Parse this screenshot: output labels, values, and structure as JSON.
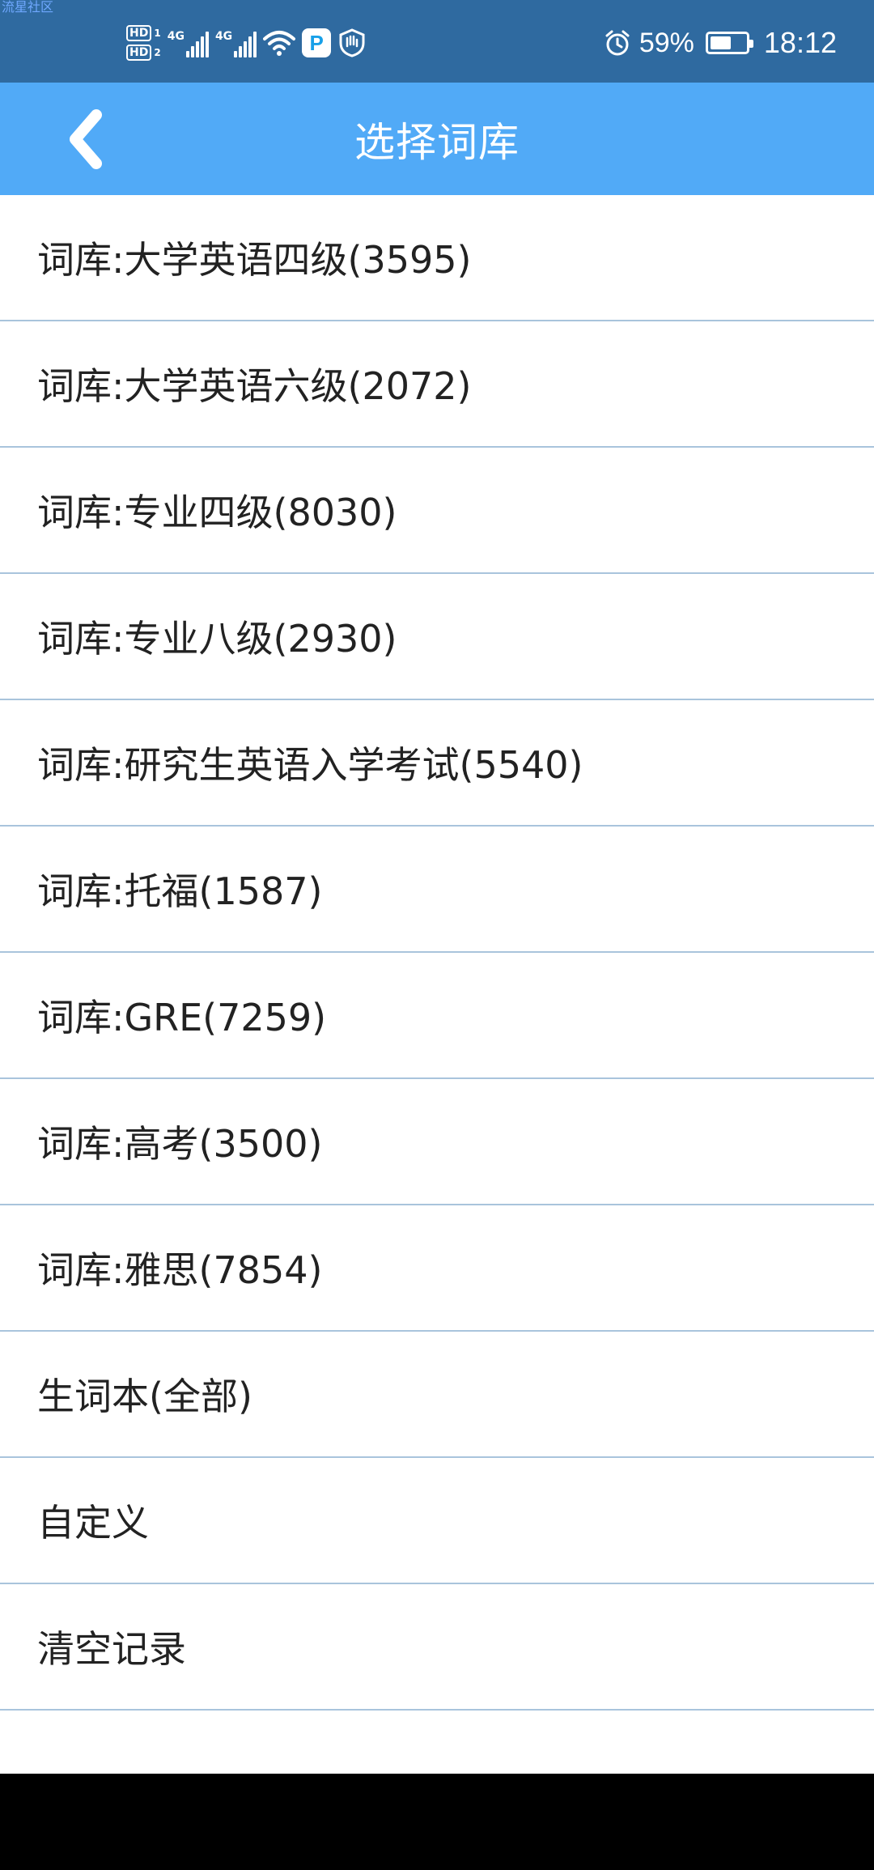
{
  "status_bar": {
    "watermark": "流星社区",
    "hd1": "HD",
    "hd1_sub": "1",
    "hd2": "HD",
    "hd2_sub": "2",
    "signal1_label": "4G",
    "signal2_label": "4G",
    "app_badge_letter": "P",
    "battery_percent": "59%",
    "battery_level": 0.59,
    "time": "18:12"
  },
  "header": {
    "title": "选择词库",
    "back_icon": "chevron-left-icon"
  },
  "list": {
    "items": [
      {
        "label": "词库:大学英语四级(3595)"
      },
      {
        "label": "词库:大学英语六级(2072)"
      },
      {
        "label": "词库:专业四级(8030)"
      },
      {
        "label": "词库:专业八级(2930)"
      },
      {
        "label": "词库:研究生英语入学考试(5540)"
      },
      {
        "label": "词库:托福(1587)"
      },
      {
        "label": "词库:GRE(7259)"
      },
      {
        "label": "词库:高考(3500)"
      },
      {
        "label": "词库:雅思(7854)"
      },
      {
        "label": "生词本(全部)"
      },
      {
        "label": "自定义"
      },
      {
        "label": "清空记录"
      }
    ]
  },
  "colors": {
    "status_bar": "#2f6aa0",
    "title_bar": "#51aaf7",
    "divider": "#a9c4dc"
  }
}
